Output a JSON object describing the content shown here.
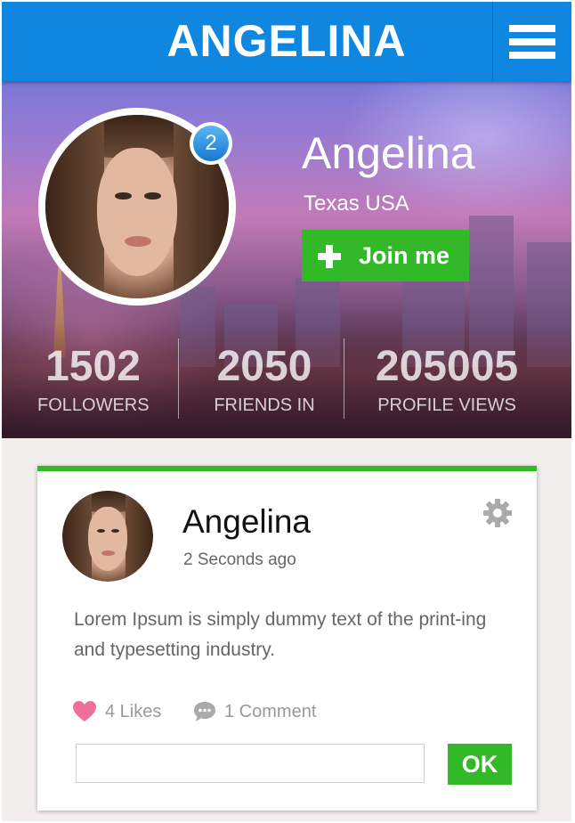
{
  "header": {
    "title": "ANGELINA",
    "menu_icon": "hamburger-menu-icon"
  },
  "profile": {
    "name": "Angelina",
    "location": "Texas USA",
    "notification_count": "2",
    "join_label": "Join me",
    "join_icon": "plus-icon"
  },
  "stats": [
    {
      "value": "1502",
      "label": "FOLLOWERS"
    },
    {
      "value": "2050",
      "label": "FRIENDS IN"
    },
    {
      "value": "205005",
      "label": "PROFILE VIEWS"
    }
  ],
  "post": {
    "author": "Angelina",
    "time": "2 Seconds ago",
    "settings_icon": "gear-icon",
    "text": "Lorem Ipsum is simply dummy text of the print-ing and typesetting industry.",
    "likes_label": "4 Likes",
    "likes_icon": "heart-icon",
    "comments_label": "1 Comment",
    "comments_icon": "speech-bubble-icon",
    "comment_value": "",
    "ok_label": "OK"
  },
  "colors": {
    "header_blue": "#0f87e1",
    "accent_green": "#31b928",
    "badge_blue": "#1577cf",
    "heart_pink": "#f06e9a"
  }
}
